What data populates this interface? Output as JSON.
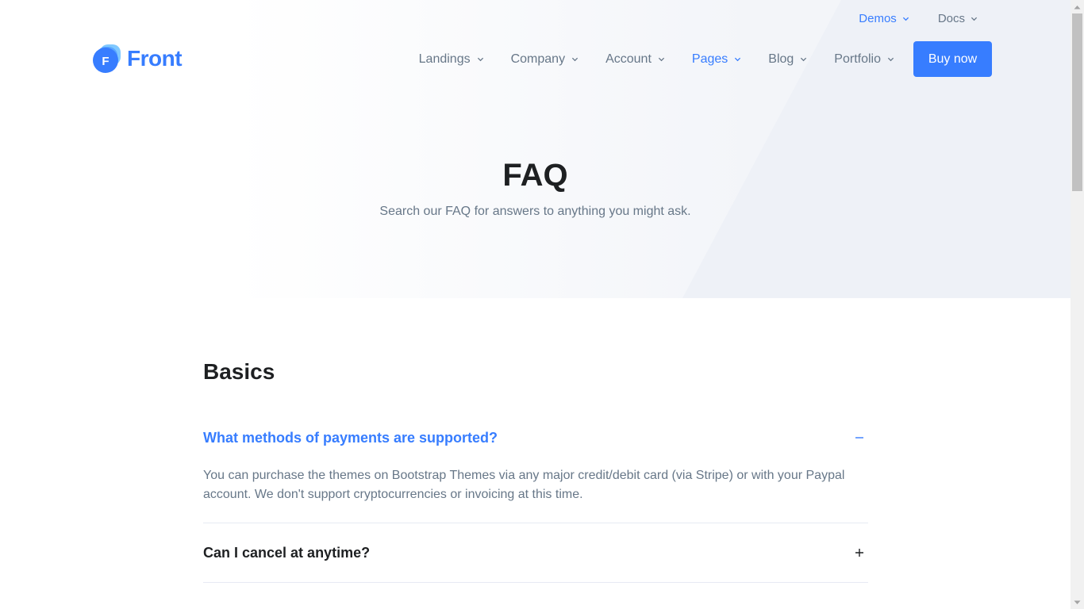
{
  "header": {
    "logo_text": "Front",
    "logo_badge": "F",
    "topbar": [
      {
        "label": "Demos",
        "active": true
      },
      {
        "label": "Docs",
        "active": false
      }
    ],
    "nav": [
      {
        "label": "Landings",
        "active": false
      },
      {
        "label": "Company",
        "active": false
      },
      {
        "label": "Account",
        "active": false
      },
      {
        "label": "Pages",
        "active": true
      },
      {
        "label": "Blog",
        "active": false
      },
      {
        "label": "Portfolio",
        "active": false
      }
    ],
    "buy_label": "Buy now"
  },
  "hero": {
    "title": "FAQ",
    "subtitle": "Search our FAQ for answers to anything you might ask."
  },
  "faq": {
    "section_title": "Basics",
    "items": [
      {
        "question": "What methods of payments are supported?",
        "answer": "You can purchase the themes on Bootstrap Themes via any major credit/debit card (via Stripe) or with your Paypal account. We don't support cryptocurrencies or invoicing at this time.",
        "open": true
      },
      {
        "question": "Can I cancel at anytime?",
        "open": false
      }
    ]
  },
  "colors": {
    "accent": "#377dff",
    "text_dark": "#1e2022",
    "text_muted": "#677788",
    "hero_bg": "#f3f5f9"
  },
  "icons": [
    "logo-icon",
    "chevron-down-icon",
    "minus-icon",
    "plus-icon"
  ]
}
